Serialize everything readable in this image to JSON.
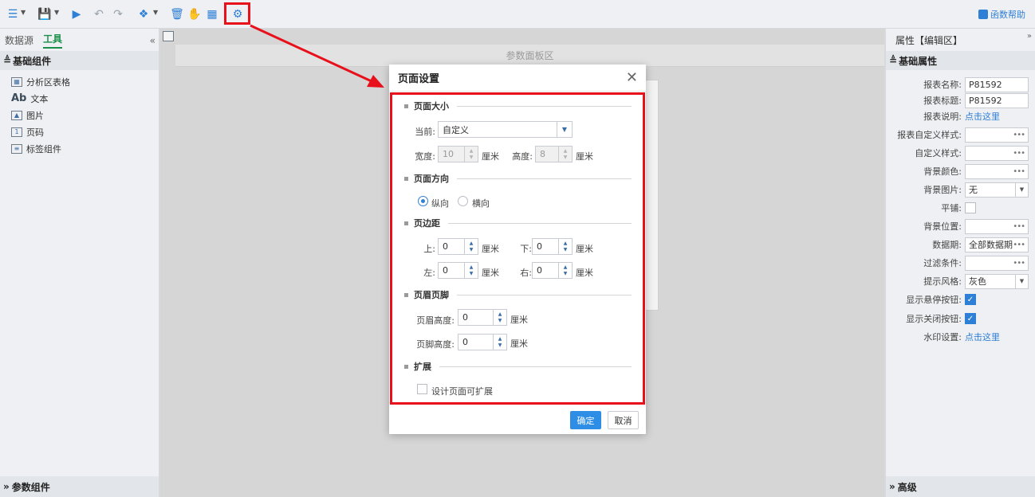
{
  "toolbar": {
    "help_label": "函数帮助"
  },
  "left_panel": {
    "tabs": [
      "数据源",
      "工具"
    ],
    "active_tab": "工具",
    "section_title": "基础组件",
    "items": [
      {
        "label": "分析区表格",
        "icon": "table-icon"
      },
      {
        "label": "文本",
        "icon": "text-ab-icon",
        "glyph": "Ab"
      },
      {
        "label": "图片",
        "icon": "image-icon"
      },
      {
        "label": "页码",
        "icon": "page-number-icon"
      },
      {
        "label": "标签组件",
        "icon": "tag-component-icon"
      }
    ],
    "footer_title": "参数组件"
  },
  "canvas": {
    "param_area_label": "参数面板区"
  },
  "right_panel": {
    "title": "属性【编辑区】",
    "section_title": "基础属性",
    "props": [
      {
        "label": "报表名称:",
        "type": "input",
        "value": "P81592"
      },
      {
        "label": "报表标题:",
        "type": "input",
        "value": "P81592"
      },
      {
        "label": "报表说明:",
        "type": "link",
        "value": "点击这里"
      },
      {
        "label": "报表自定义样式:",
        "type": "dots",
        "value": ""
      },
      {
        "label": "自定义样式:",
        "type": "dots",
        "value": ""
      },
      {
        "label": "背景颜色:",
        "type": "dots",
        "value": ""
      },
      {
        "label": "背景图片:",
        "type": "select",
        "value": "无"
      },
      {
        "label": "平铺:",
        "type": "check",
        "value": "off"
      },
      {
        "label": "背景位置:",
        "type": "dots",
        "value": ""
      },
      {
        "label": "数据期:",
        "type": "dots",
        "value": "全部数据期"
      },
      {
        "label": "过滤条件:",
        "type": "dots",
        "value": ""
      },
      {
        "label": "提示风格:",
        "type": "select",
        "value": "灰色"
      },
      {
        "label": "显示悬停按钮:",
        "type": "check",
        "value": "on"
      },
      {
        "label": "显示关闭按钮:",
        "type": "check",
        "value": "on"
      },
      {
        "label": "水印设置:",
        "type": "link",
        "value": "点击这里"
      }
    ],
    "footer_title": "高级"
  },
  "dialog": {
    "title": "页面设置",
    "page_size": {
      "title": "页面大小",
      "current_label": "当前:",
      "current_value": "自定义",
      "width_label": "宽度:",
      "width_value": "10",
      "height_label": "高度:",
      "height_value": "8",
      "unit": "厘米"
    },
    "orientation": {
      "title": "页面方向",
      "portrait": "纵向",
      "landscape": "横向",
      "selected": "纵向"
    },
    "margins": {
      "title": "页边距",
      "top_label": "上:",
      "top_value": "0",
      "bottom_label": "下:",
      "bottom_value": "0",
      "left_label": "左:",
      "left_value": "0",
      "right_label": "右:",
      "right_value": "0",
      "unit": "厘米"
    },
    "header_footer": {
      "title": "页眉页脚",
      "header_label": "页眉高度:",
      "header_value": "0",
      "footer_label": "页脚高度:",
      "footer_value": "0",
      "unit": "厘米"
    },
    "extend": {
      "title": "扩展",
      "checkbox_label": "设计页面可扩展"
    },
    "ok_label": "确定",
    "cancel_label": "取消"
  },
  "colors": {
    "highlight": "#e8101a",
    "accent": "#2e7fd6",
    "tab_active": "#1a8f4a"
  }
}
